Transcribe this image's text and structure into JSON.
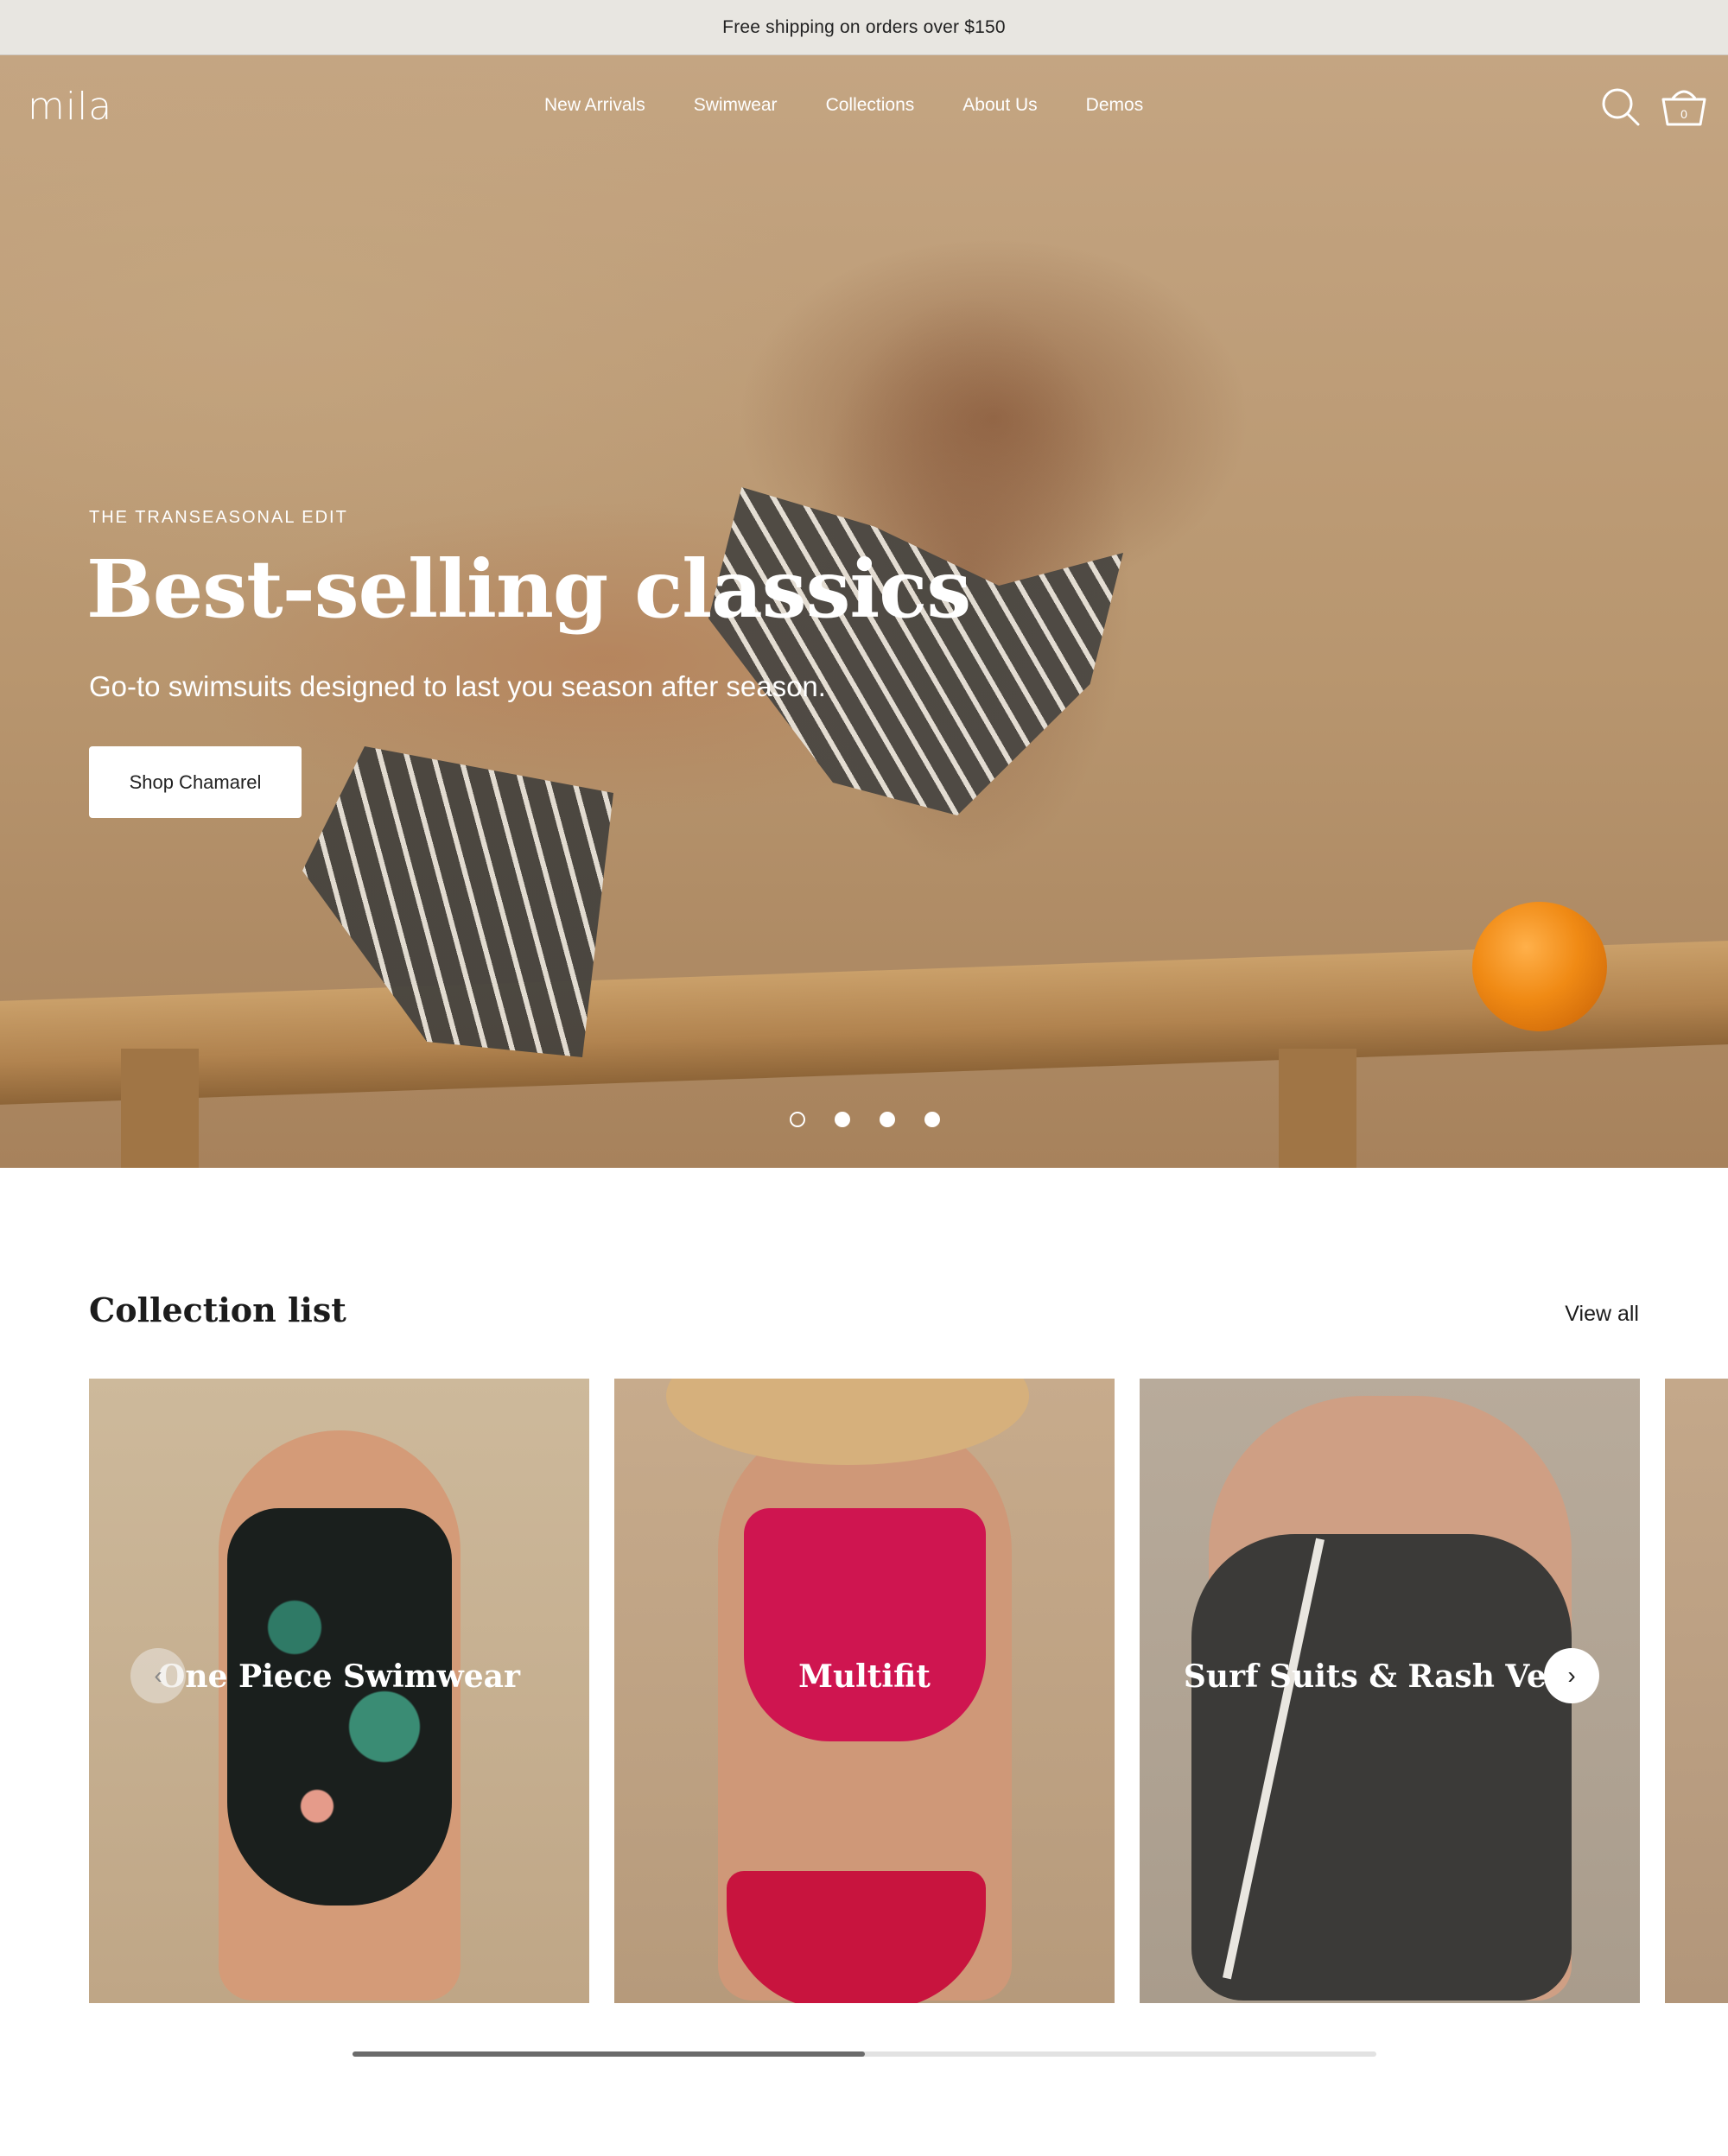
{
  "announcement": {
    "text": "Free shipping on orders over $150"
  },
  "header": {
    "logo": "mila",
    "nav": [
      "New Arrivals",
      "Swimwear",
      "Collections",
      "About Us",
      "Demos"
    ],
    "cart_count": "0",
    "icons": [
      "search-icon",
      "cart-icon"
    ]
  },
  "hero": {
    "eyebrow": "THE TRANSEASONAL EDIT",
    "title": "Best-selling classics",
    "subtitle": "Go-to swimsuits designed to last you season after season.",
    "button": "Shop Chamarel",
    "slides_total": 4,
    "active_slide": 1
  },
  "collection_list": {
    "title": "Collection list",
    "view_all": "View all",
    "items": [
      {
        "label": "One Piece Swimwear"
      },
      {
        "label": "Multifit"
      },
      {
        "label": "Surf Suits & Rash Vests"
      }
    ],
    "prev_icon": "chevron-left-icon",
    "next_icon": "chevron-right-icon",
    "scroll_progress": 0.5
  },
  "colors": {
    "announcement_bg": "#e8e6e1",
    "text_dark": "#1c1c1c",
    "white": "#ffffff"
  }
}
